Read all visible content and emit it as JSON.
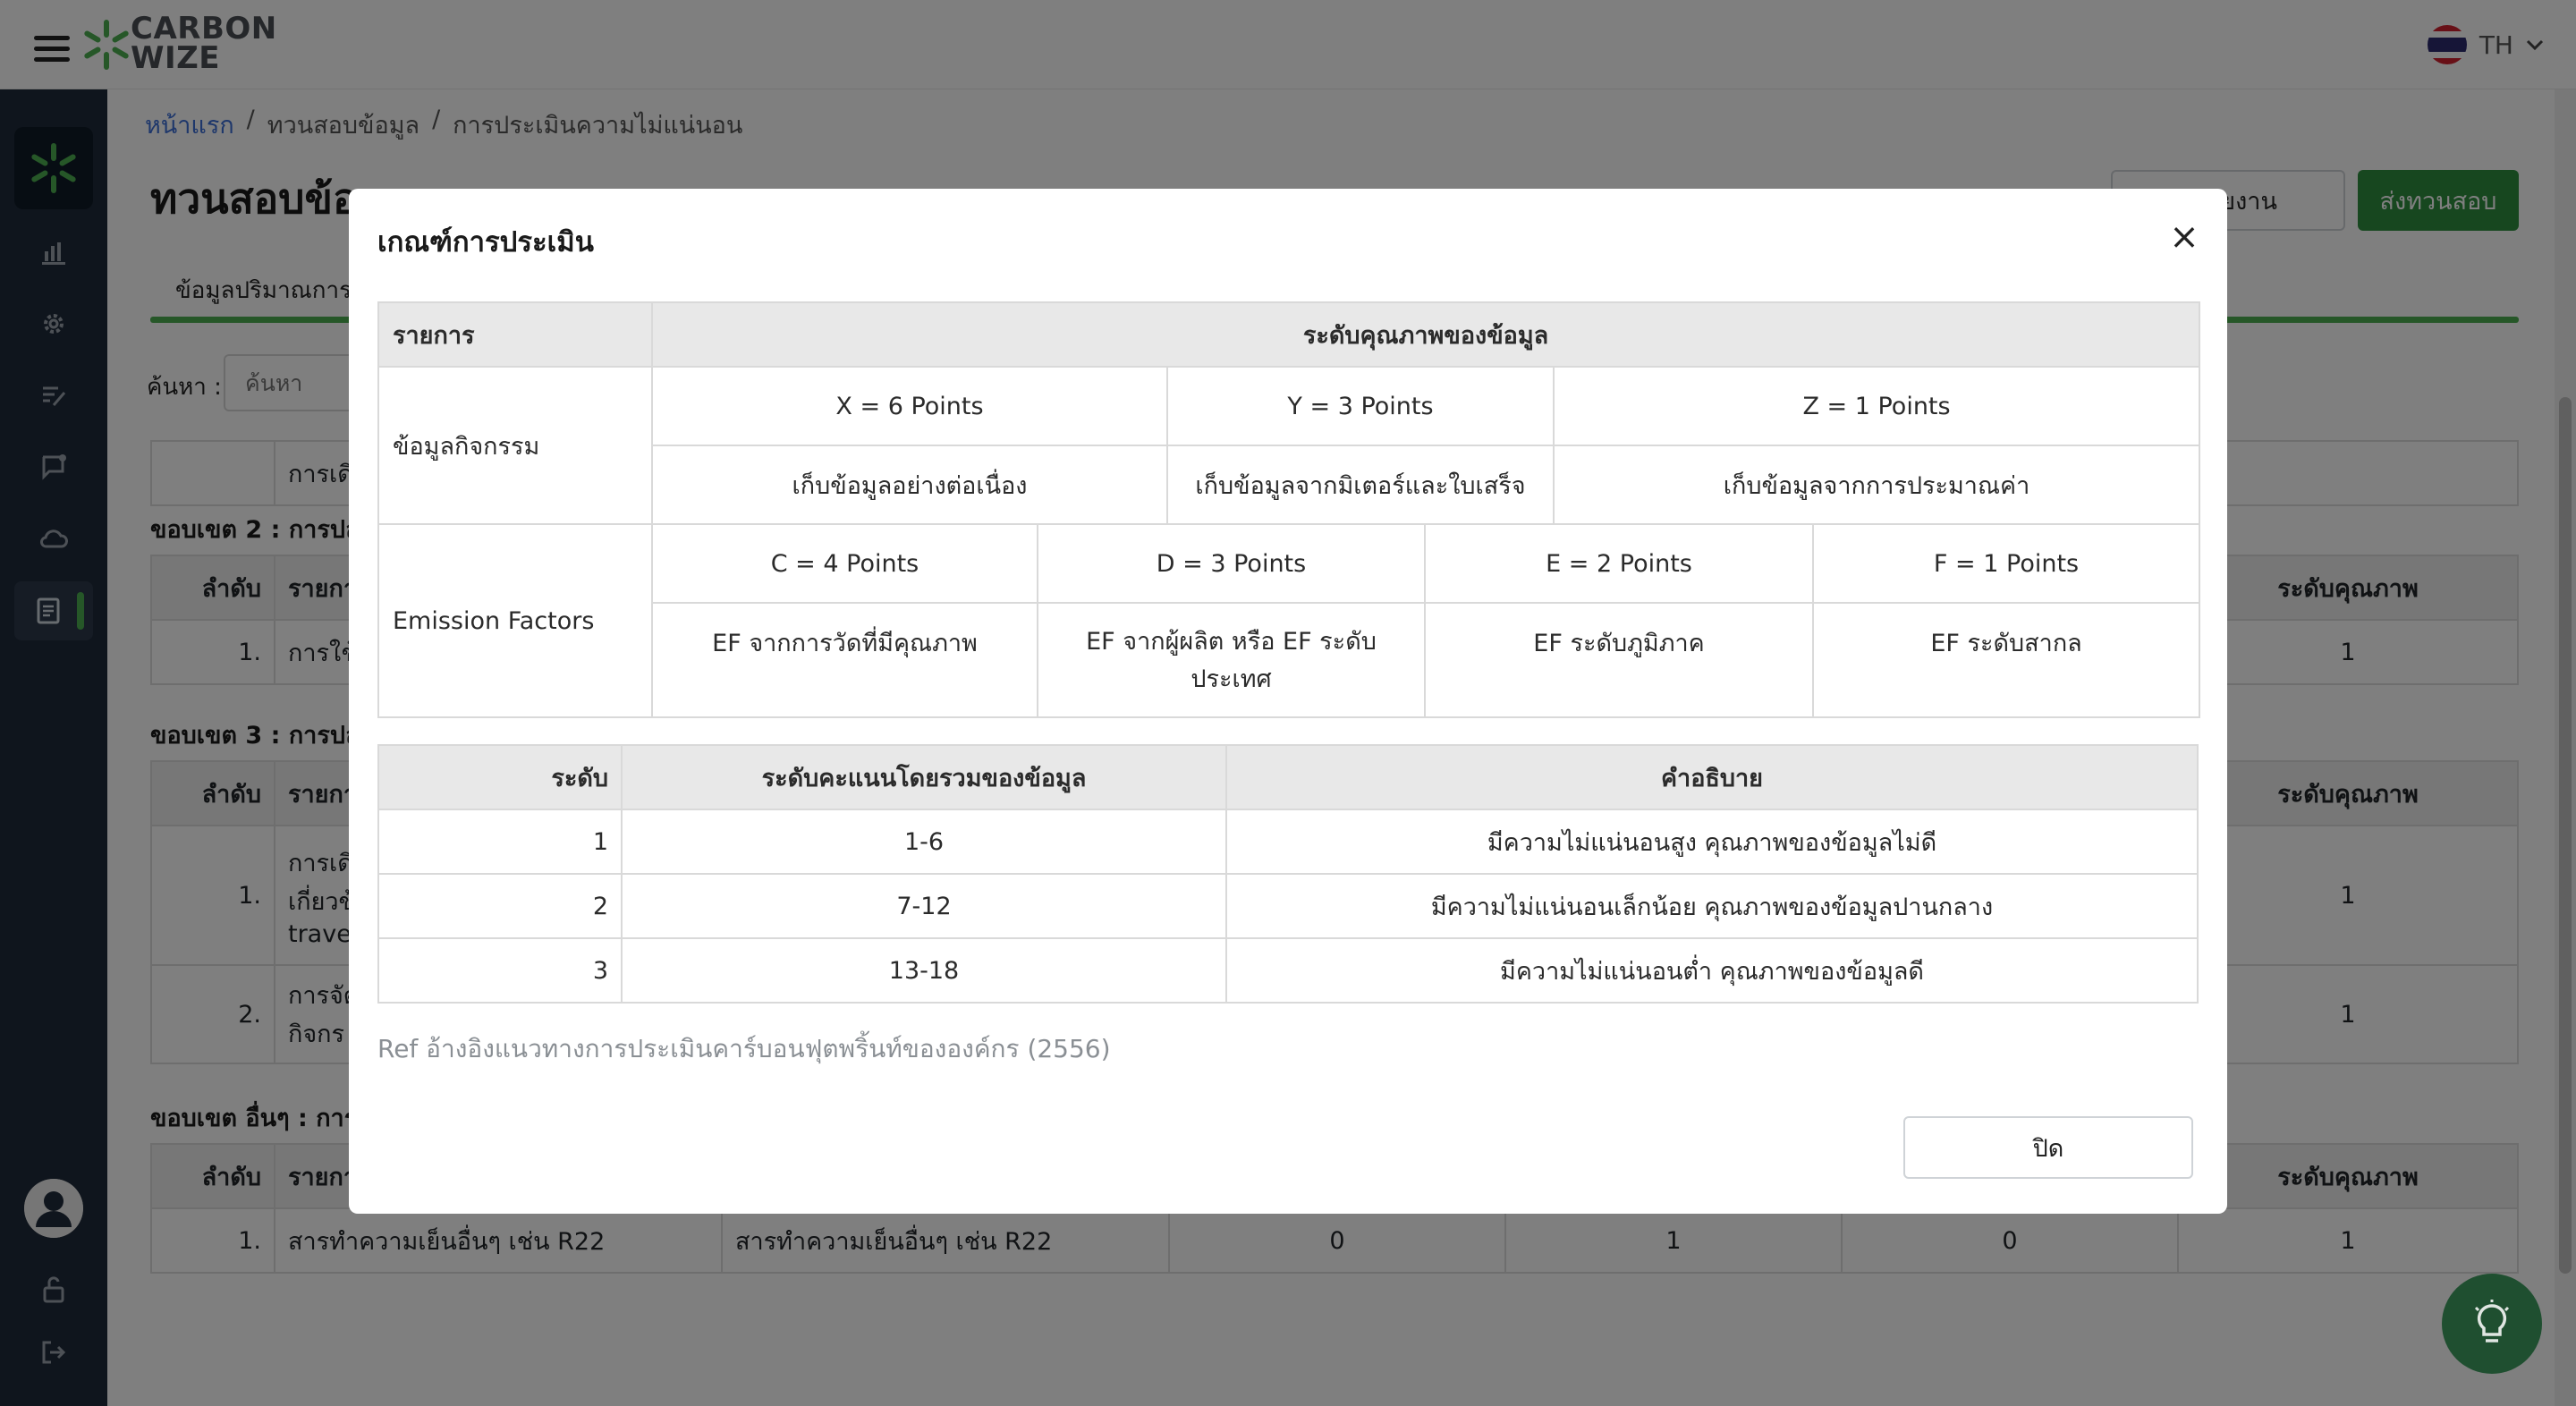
{
  "app": {
    "logo_line1": "CARBON",
    "logo_line2": "WIZE",
    "brand_green": "#4caf50",
    "sidebar_bg": "#1f2a3a"
  },
  "topbar": {
    "language": "TH"
  },
  "breadcrumb": {
    "home": "หน้าแรก",
    "sep": "/",
    "level2": "ทวนสอบข้อมูล",
    "level3": "การประเมินความไม่แน่นอน"
  },
  "page": {
    "title": "ทวนสอบข้อมูล",
    "report_button": "ดูรายงาน",
    "submit_button": "ส่งทวนสอบ",
    "tab": "ข้อมูลปริมาณการปล่อย",
    "search_label": "ค้นหา :",
    "search_placeholder": "ค้นหา"
  },
  "background": {
    "row_top_text": "การเดิ",
    "sections": [
      {
        "title": "ขอบเขต 2 : การปล่อย"
      },
      {
        "title": "ขอบเขต 3 : การปล่อย"
      },
      {
        "title": "ขอบเขต อื่นๆ : การปล่อย"
      }
    ],
    "header": {
      "num": "ลำดับ",
      "name": "รายการ",
      "quality": "ระดับคุณภาพ"
    },
    "scope2_rows": [
      {
        "num": "1.",
        "name": "การใช้",
        "quality": "1"
      }
    ],
    "scope3_rows": [
      {
        "num": "1.",
        "name": "การเดิ",
        "name2": "เกี่ยวข้",
        "name3": "trave",
        "quality": "1"
      },
      {
        "num": "2.",
        "name": "การจัด",
        "name2": "กิจกร",
        "quality": "1"
      }
    ],
    "other_rows": [
      {
        "num": "1.",
        "name": "สารทำความเย็นอื่นๆ เช่น R22",
        "source": "สารทำความเย็นอื่นๆ เช่น R22",
        "v1": "0",
        "v2": "1",
        "v3": "0",
        "quality": "1"
      }
    ]
  },
  "modal": {
    "title": "เกณฑ์การประเมิน",
    "close_label": "×",
    "criteria_header": {
      "item": "รายการ",
      "quality": "ระดับคุณภาพของข้อมูล"
    },
    "activity": {
      "label": "ข้อมูลกิจกรรม",
      "points": [
        "X = 6 Points",
        "Y = 3 Points",
        "Z = 1 Points"
      ],
      "desc": [
        "เก็บข้อมูลอย่างต่อเนื่อง",
        "เก็บข้อมูลจากมิเตอร์และใบเสร็จ",
        "เก็บข้อมูลจากการประมาณค่า"
      ]
    },
    "emission": {
      "label": "Emission Factors",
      "points": [
        "C = 4 Points",
        "D = 3 Points",
        "E = 2 Points",
        "F = 1 Points"
      ],
      "desc": [
        "EF จากการวัดที่มีคุณภาพ",
        "EF จากผู้ผลิต หรือ EF ระดับประเทศ",
        "EF ระดับภูมิภาค",
        "EF ระดับสากล"
      ]
    },
    "level_header": {
      "level": "ระดับ",
      "score": "ระดับคะแนนโดยรวมของข้อมูล",
      "desc": "คำอธิบาย"
    },
    "levels": [
      {
        "level": "1",
        "score": "1-6",
        "desc": "มีความไม่แน่นอนสูง คุณภาพของข้อมูลไม่ดี"
      },
      {
        "level": "2",
        "score": "7-12",
        "desc": "มีความไม่แน่นอนเล็กน้อย คุณภาพของข้อมูลปานกลาง"
      },
      {
        "level": "3",
        "score": "13-18",
        "desc": "มีความไม่แน่นอนต่ำ คุณภาพของข้อมูลดี"
      }
    ],
    "reference": "Ref อ้างอิงแนวทางการประเมินคาร์บอนฟุตพริ้นท์ขององค์กร (2556)",
    "close_button": "ปิด"
  }
}
